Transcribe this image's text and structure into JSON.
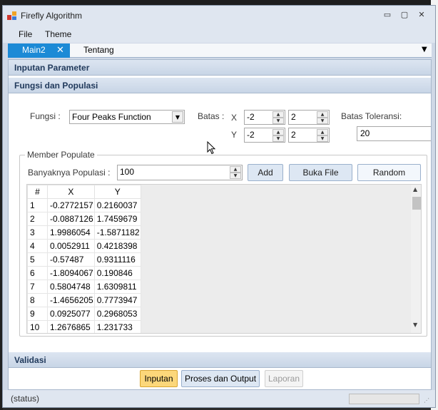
{
  "window": {
    "title": "Firefly Algorithm",
    "minimize_glyph": "▭",
    "restore_glyph": "▢",
    "close_glyph": "✕"
  },
  "menu": {
    "items": [
      "File",
      "Theme"
    ]
  },
  "tabs": {
    "active": {
      "label": "Main2",
      "close_glyph": "✕"
    },
    "inactive": {
      "label": "Tentang"
    },
    "dropdown_glyph": "▼"
  },
  "sections": {
    "inputan_parameter": "Inputan Parameter",
    "fungsi_populasi": "Fungsi dan Populasi",
    "validasi": "Validasi"
  },
  "params": {
    "fungsi_label": "Fungsi :",
    "fungsi_value": "Four Peaks Function",
    "batas_label": "Batas :",
    "x_label": "X",
    "y_label": "Y",
    "x_min": "-2",
    "x_max": "2",
    "y_min": "-2",
    "y_max": "2",
    "toleransi_label": "Batas Toleransi:",
    "toleransi_value": "20"
  },
  "member_populate": {
    "group_title": "Member Populate",
    "populasi_label": "Banyaknya Populasi :",
    "populasi_value": "100",
    "add_button": "Add",
    "buka_file_button": "Buka File",
    "random_button": "Random"
  },
  "table": {
    "headers": [
      "#",
      "X",
      "Y"
    ],
    "rows": [
      [
        "1",
        "-0.2772157",
        "0.2160037"
      ],
      [
        "2",
        "-0.0887126",
        "1.7459679"
      ],
      [
        "3",
        "1.9986054",
        "-1.5871182"
      ],
      [
        "4",
        "0.0052911",
        "0.4218398"
      ],
      [
        "5",
        "-0.57487",
        "0.9311116"
      ],
      [
        "6",
        "-1.8094067",
        "0.190846"
      ],
      [
        "7",
        "0.5804748",
        "1.6309811"
      ],
      [
        "8",
        "-1.4656205",
        "0.7773947"
      ],
      [
        "9",
        "0.0925077",
        "0.2968053"
      ],
      [
        "10",
        "1.2676865",
        "1.231733"
      ]
    ]
  },
  "footer": {
    "inputan": "Inputan",
    "proses": "Proses dan Output",
    "laporan": "Laporan"
  },
  "status": {
    "text": "(status)",
    "progress": 0
  },
  "colors": {
    "tab_active": "#1c8ad6",
    "inputan_button": "#fcd77a",
    "section_header": "#c8d5e6"
  }
}
